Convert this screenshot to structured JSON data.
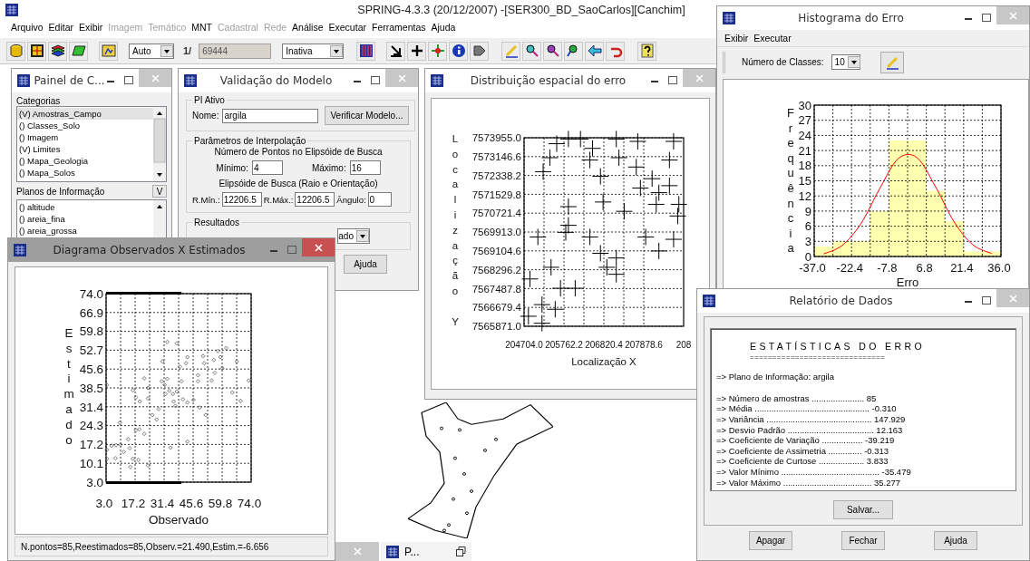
{
  "app": {
    "title": "SPRING-4.3.3 (20/12/2007) -[SER300_BD_SaoCarlos][Canchim]",
    "menu": [
      {
        "label": "Arquivo",
        "disabled": false
      },
      {
        "label": "Editar",
        "disabled": false
      },
      {
        "label": "Exibir",
        "disabled": false
      },
      {
        "label": "Imagem",
        "disabled": true
      },
      {
        "label": "Temático",
        "disabled": true
      },
      {
        "label": "MNT",
        "disabled": false
      },
      {
        "label": "Cadastral",
        "disabled": true
      },
      {
        "label": "Rede",
        "disabled": true
      },
      {
        "label": "Análise",
        "disabled": false
      },
      {
        "label": "Executar",
        "disabled": false
      },
      {
        "label": "Ferramentas",
        "disabled": false
      },
      {
        "label": "Ajuda",
        "disabled": false
      }
    ],
    "toolbar": {
      "scale_mode": "Auto",
      "scale_prefix": "1/",
      "scale": "69444",
      "mode": "Inativa"
    }
  },
  "painel": {
    "title": "Painel de C...",
    "active": false,
    "categories_label": "Categorias",
    "categories": [
      {
        "label": "(V) Amostras_Campo",
        "selected": true
      },
      {
        "label": "() Classes_Solo",
        "selected": false
      },
      {
        "label": "() Imagem",
        "selected": false
      },
      {
        "label": "(V) Limites",
        "selected": false
      },
      {
        "label": "() Mapa_Geologia",
        "selected": false
      },
      {
        "label": "() Mapa_Solos",
        "selected": false
      }
    ],
    "planes_label": "Planos de Informação",
    "planes_toggle": "V",
    "planes": [
      {
        "label": "() altitude",
        "selected": false
      },
      {
        "label": "() areia_fina",
        "selected": false
      },
      {
        "label": "() areia_grossa",
        "selected": false
      }
    ]
  },
  "validacao": {
    "title": "Validação do Modelo",
    "active": false,
    "pi_group": "PI Ativo",
    "name_label": "Nome:",
    "name_value": "argila",
    "verify_button": "Verificar Modelo...",
    "interp_group": "Parâmetros de Interpolação",
    "points_heading": "Número de Pontos no Elipsóide de Busca",
    "min_label": "Mínimo:",
    "min_value": "4",
    "max_label": "Máximo:",
    "max_value": "16",
    "ellipse_heading": "Elipsóide de Busca (Raio e Orientação)",
    "rmin_label": "R.Mín.:",
    "rmin_value": "12206.5",
    "rmax_label": "R.Máx.:",
    "rmax_value": "12206.5",
    "angle_label": "Ângulo:",
    "angle_value": "0",
    "results_group": "Resultados",
    "results_select": "ado",
    "help_button": "Ajuda"
  },
  "distribuicao": {
    "title": "Distribuição espacial do erro",
    "active": false,
    "cut_tick_label": "208",
    "chart_data": {
      "type": "scatter",
      "xlabel": "Localização X",
      "ylabel": "Localização Y",
      "xlim": [
        204704.0,
        208936.8
      ],
      "ylim": [
        7565871.0,
        7573955.0
      ],
      "xticks": [
        {
          "value": 204704.0,
          "label": "204704.0"
        },
        {
          "value": 205762.2,
          "label": "205762.2"
        },
        {
          "value": 206820.4,
          "label": "206820.4"
        },
        {
          "value": 207878.6,
          "label": "207878.6"
        }
      ],
      "yticks": [
        {
          "value": 7565871.0,
          "label": "7565871.0"
        },
        {
          "value": 7566679.4,
          "label": "7566679.4"
        },
        {
          "value": 7567487.8,
          "label": "7567487.8"
        },
        {
          "value": 7568296.2,
          "label": "7568296.2"
        },
        {
          "value": 7569104.6,
          "label": "7569104.6"
        },
        {
          "value": 7569913.0,
          "label": "7569913.0"
        },
        {
          "value": 7570721.4,
          "label": "7570721.4"
        },
        {
          "value": 7571529.8,
          "label": "7571529.8"
        },
        {
          "value": 7572338.2,
          "label": "7572338.2"
        },
        {
          "value": 7573146.6,
          "label": "7573146.6"
        },
        {
          "value": 7573955.0,
          "label": "7573955.0"
        }
      ],
      "grid": true,
      "x": [
        205570,
        205390,
        205880,
        206200,
        206520,
        206450,
        207150,
        207220,
        207720,
        207680,
        208670,
        208560,
        205210,
        206730,
        205880,
        205880,
        205810,
        205070,
        206450,
        206800,
        207360,
        207790,
        208100,
        208280,
        208210,
        208560,
        208810,
        208780,
        207930,
        208280,
        208670,
        206730,
        206900,
        207150,
        207150,
        205420,
        204860,
        205670,
        206060,
        205180,
        205530,
        204820,
        205180
      ],
      "series": [
        {
          "color": "#000000",
          "values": [
            7573700,
            7573100,
            7573900,
            7573900,
            7573500,
            7573000,
            7573900,
            7573100,
            7573800,
            7572700,
            7573800,
            7573000,
            7572500,
            7572300,
            7571000,
            7570200,
            7569900,
            7569700,
            7569700,
            7571200,
            7570800,
            7571800,
            7572200,
            7571600,
            7571100,
            7571900,
            7571100,
            7570600,
            7569700,
            7569100,
            7569600,
            7569000,
            7568400,
            7568800,
            7568100,
            7568400,
            7567900,
            7567500,
            7567500,
            7566800,
            7566600,
            7566300,
            7566000
          ]
        }
      ]
    }
  },
  "histograma": {
    "title": "Histograma do Erro",
    "active": false,
    "menu": [
      "Exibir",
      "Executar"
    ],
    "classes_label": "Número de Classes:",
    "classes_value": "10",
    "chart_data": {
      "type": "bar",
      "xlabel": "Erro",
      "ylabel": "Frequência",
      "xlim": [
        -37.0,
        36.0
      ],
      "ylim": [
        0,
        30
      ],
      "xticks": [
        {
          "value": -37.0,
          "label": "-37.0"
        },
        {
          "value": -22.4,
          "label": "-22.4"
        },
        {
          "value": -7.8,
          "label": "-7.8"
        },
        {
          "value": 6.8,
          "label": "6.8"
        },
        {
          "value": 21.4,
          "label": "21.4"
        },
        {
          "value": 36.0,
          "label": "36.0"
        }
      ],
      "yticks": [
        0,
        3,
        6,
        9,
        12,
        15,
        18,
        21,
        24,
        27,
        30
      ],
      "grid": true,
      "x": [
        -33.35,
        -26.05,
        -18.75,
        -11.45,
        -4.15,
        3.15,
        10.45,
        17.75,
        25.05,
        32.35
      ],
      "series": [
        {
          "type": "bar",
          "color": "#ffffb0",
          "values": [
            2,
            3,
            3,
            9,
            23,
            23,
            13,
            7,
            1,
            1
          ]
        },
        {
          "type": "line",
          "color": "#ff0000",
          "values": [
            0.5,
            2.2,
            6.5,
            13.4,
            19.4,
            19.6,
            13.8,
            6.8,
            2.3,
            0.6
          ]
        }
      ]
    }
  },
  "relatorio": {
    "title": "Relatório de Dados",
    "active": false,
    "heading": "ESTATÍSTICAS DO ERRO",
    "rule": "==============================",
    "plane_line": "=> Plano de Informação: argila",
    "lines": [
      "=> Número de amostras ...................... 85",
      "=> Média ................................................ -0.310",
      "=> Variância ............................................ 147.929",
      "=> Desvio Padrão .................................... 12.163",
      "=> Coeficiente de Variação ................. -39.219",
      "=> Coeficiente de Assimetria .............. -0.313",
      "=> Coeficiente de Curtose ................... 3.833",
      "=> Valor Mínimo ......................................... -35.479",
      "=> Valor Máximo ..................................... 35.277"
    ],
    "save_button": "Salvar...",
    "buttons": [
      "Apagar",
      "Fechar",
      "Ajuda"
    ]
  },
  "diagrama": {
    "title": "Diagrama Observados X Estimados",
    "active": true,
    "chart_data": {
      "type": "scatter",
      "xlabel": "Observado",
      "ylabel": "Estimado",
      "xlim": [
        3.0,
        74.0
      ],
      "ylim": [
        3.0,
        74.0
      ],
      "xticks": [
        {
          "value": 3.0,
          "label": "3.0"
        },
        {
          "value": 17.2,
          "label": "17.2"
        },
        {
          "value": 31.4,
          "label": "31.4"
        },
        {
          "value": 45.6,
          "label": "45.6"
        },
        {
          "value": 59.8,
          "label": "59.8"
        },
        {
          "value": 74.0,
          "label": "74.0"
        }
      ],
      "yticks": [
        {
          "value": 3.0,
          "label": "3.0"
        },
        {
          "value": 10.1,
          "label": "10.1"
        },
        {
          "value": 17.2,
          "label": "17.2"
        },
        {
          "value": 24.3,
          "label": "24.3"
        },
        {
          "value": 31.4,
          "label": "31.4"
        },
        {
          "value": 38.5,
          "label": "38.5"
        },
        {
          "value": 45.6,
          "label": "45.6"
        },
        {
          "value": 52.7,
          "label": "52.7"
        },
        {
          "value": 59.8,
          "label": "59.8"
        },
        {
          "value": 66.9,
          "label": "66.9"
        },
        {
          "value": 74.0,
          "label": "74.0"
        }
      ],
      "grid": true,
      "x": [
        3.4,
        5.7,
        7.9,
        10.1,
        11.6,
        13.8,
        14.6,
        16.1,
        14.9,
        18.8,
        23.5,
        3.4,
        7.6,
        9.7,
        17.6,
        19.3,
        21.7,
        16.1,
        17.6,
        19.5,
        21.7,
        23.5,
        23.5,
        25.7,
        27.7,
        28.7,
        30.6,
        32.9,
        37.6,
        30.2,
        31.7,
        32.9,
        32.1,
        33.9,
        35.7,
        36.1,
        36.9,
        37.6,
        39.1,
        39.9,
        40.6,
        42.1,
        42.8,
        42.8,
        42.8,
        34.6,
        45.8,
        48.0,
        48.0,
        48.8,
        50.5,
        51.0,
        51.7,
        54.7,
        55.7,
        56.2,
        57.7,
        58.9,
        59.9,
        61.8,
        64.8,
        67.0,
        68.8,
        72.8,
        3.4
      ],
      "series": [
        {
          "color": "#555555",
          "values": [
            15.2,
            16.7,
            16.9,
            17.1,
            14.4,
            19.2,
            15.8,
            11.8,
            8.7,
            11.4,
            9.3,
            11.8,
            12.0,
            25.4,
            22.6,
            22.9,
            21.2,
            37.6,
            34.9,
            33.4,
            42.1,
            34.5,
            38.5,
            28.3,
            26.6,
            30.5,
            48.5,
            55.8,
            55.3,
            41.0,
            39.6,
            41.9,
            36.2,
            37.4,
            36.2,
            33.4,
            31.7,
            37.1,
            46.5,
            41.0,
            34.2,
            47.8,
            50.1,
            33.0,
            18.3,
            16.0,
            34.0,
            43.3,
            41.0,
            31.1,
            50.5,
            47.8,
            28.3,
            41.3,
            49.0,
            44.2,
            52.4,
            50.1,
            45.9,
            53.5,
            36.8,
            48.4,
            33.6,
            41.3,
            39.6
          ]
        }
      ]
    },
    "status": "N.pontos=85,Reestimados=85,Observ.=21.490,Estim.=-6.656"
  },
  "minimized": [
    {
      "title": "P..."
    }
  ]
}
